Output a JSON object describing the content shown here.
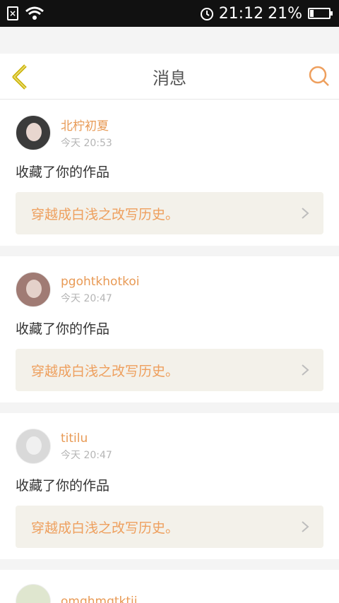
{
  "status_bar": {
    "time": "21:12",
    "battery_percent": "21%",
    "icons": [
      "sim-alert-icon",
      "wifi-icon",
      "alarm-icon",
      "battery-icon"
    ]
  },
  "header": {
    "title": "消息",
    "back_icon": "chevron-left-icon",
    "search_icon": "search-icon"
  },
  "colors": {
    "accent": "#e89a55",
    "header_back": "#c8b000",
    "card_link_bg": "#f3f1ea"
  },
  "messages": [
    {
      "username": "北柠初夏",
      "time": "今天 20:53",
      "action": "收藏了你的作品",
      "work_title": "穿越成白浅之改写历史。"
    },
    {
      "username": "pgohtkhotkoi",
      "time": "今天 20:47",
      "action": "收藏了你的作品",
      "work_title": "穿越成白浅之改写历史。"
    },
    {
      "username": "titilu",
      "time": "今天 20:47",
      "action": "收藏了你的作品",
      "work_title": "穿越成白浅之改写历史。"
    },
    {
      "username": "omghmgtktii"
    }
  ]
}
